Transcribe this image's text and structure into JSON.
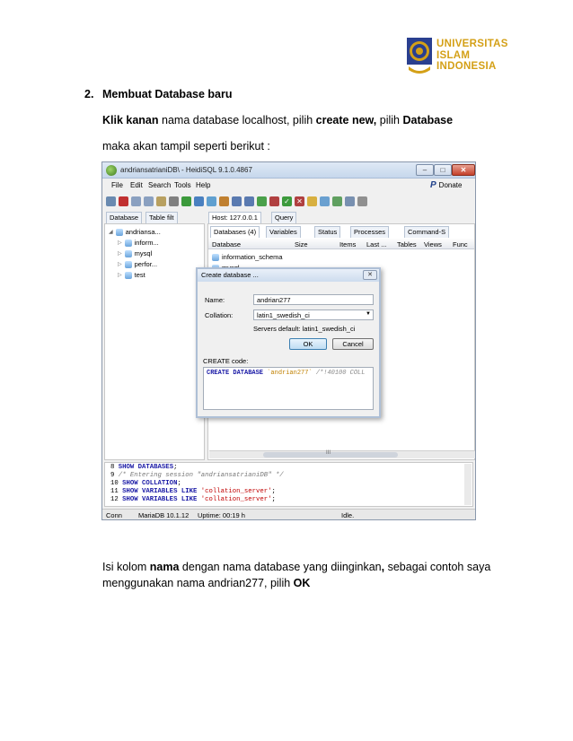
{
  "logo": {
    "lines": [
      "UNIVERSITAS",
      "ISLAM",
      "INDONESIA"
    ]
  },
  "doc": {
    "heading_num": "2.",
    "heading": "Membuat Database baru",
    "p1": {
      "b1": "Klik kanan",
      "t1": " nama database localhost, pilih ",
      "b2": "create new,",
      "t2": " pilih ",
      "b3": "Database"
    },
    "p2": "maka akan tampil seperti berikut :",
    "p3": {
      "t1": "Isi kolom ",
      "b1": "nama",
      "t2": " dengan nama database yang diinginkan",
      "b2": ",",
      "t3": " sebagai contoh saya"
    },
    "p4": {
      "t1": "menggunakan nama andrian277, pilih ",
      "b1": "OK"
    }
  },
  "app": {
    "title": "andriansatrianiDB\\ - HeidiSQL 9.1.0.4867",
    "menu": [
      "File",
      "Edit",
      "Search",
      "Tools",
      "Help"
    ],
    "donate": "Donate",
    "left_tabs": [
      "Database",
      "Table filt"
    ],
    "right_tabs": [
      "Host: 127.0.0.1",
      "Query"
    ],
    "tree": {
      "root": "andriansa...",
      "items": [
        "inform...",
        "mysql",
        "perfor...",
        "test"
      ]
    },
    "subtabs": [
      "Databases (4)",
      "Variables",
      "Status",
      "Processes",
      "Command-S"
    ],
    "columns": [
      "Database",
      "Size",
      "Items",
      "Last ...",
      "Tables",
      "Views",
      "Func"
    ],
    "databases": [
      "information_schema",
      "mysql"
    ],
    "scroll_marker": "III",
    "sql_log": [
      {
        "ln": "8",
        "parts": [
          {
            "k": "kw",
            "t": "SHOW DATABASES"
          },
          {
            "k": "",
            "t": ";"
          }
        ]
      },
      {
        "ln": "9",
        "parts": [
          {
            "k": "cm",
            "t": "/* Entering session \"andriansatrianiDB\" */"
          }
        ]
      },
      {
        "ln": "10",
        "parts": [
          {
            "k": "kw",
            "t": "SHOW COLLATION"
          },
          {
            "k": "",
            "t": ";"
          }
        ]
      },
      {
        "ln": "11",
        "parts": [
          {
            "k": "kw",
            "t": "SHOW VARIABLES LIKE "
          },
          {
            "k": "st",
            "t": "'collation_server'"
          },
          {
            "k": "",
            "t": ";"
          }
        ]
      },
      {
        "ln": "12",
        "parts": [
          {
            "k": "kw",
            "t": "SHOW VARIABLES LIKE "
          },
          {
            "k": "st",
            "t": "'collation_server'"
          },
          {
            "k": "",
            "t": ";"
          }
        ]
      }
    ],
    "status": {
      "conn": "Conn",
      "server": "MariaDB 10.1.12",
      "uptime": "Uptime: 00:19 h",
      "state": "Idle."
    }
  },
  "dialog": {
    "title": "Create database ...",
    "name_label": "Name:",
    "name_value": "andrian277",
    "collation_label": "Collation:",
    "collation_value": "latin1_swedish_ci",
    "server_default": "Servers default: latin1_swedish_ci",
    "ok": "OK",
    "cancel": "Cancel",
    "code_label": "CREATE code:",
    "code": {
      "kw": "CREATE DATABASE ",
      "st": "`andrian277`",
      "cm": " /*!40100 COLL"
    }
  }
}
